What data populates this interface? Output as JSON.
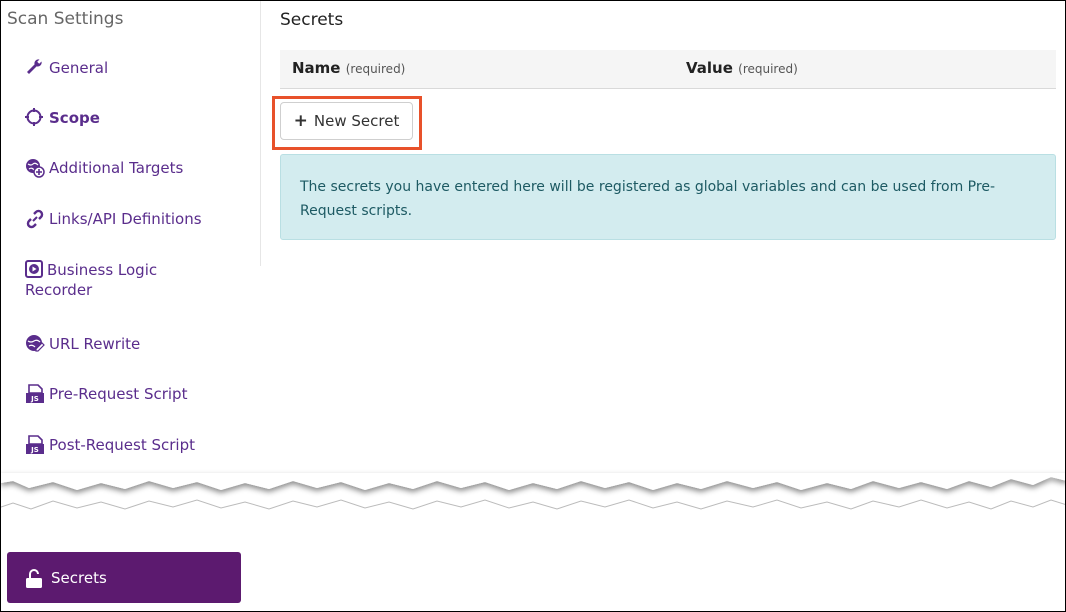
{
  "sidebar": {
    "title": "Scan Settings",
    "items": [
      {
        "label": "General",
        "icon": "wrench-icon"
      },
      {
        "label": "Scope",
        "icon": "crosshair-icon"
      },
      {
        "label": "Additional Targets",
        "icon": "globe-plus-icon"
      },
      {
        "label": "Links/API Definitions",
        "icon": "link-icon"
      },
      {
        "label": "Business Logic Recorder",
        "label_line1": "Business Logic",
        "label_line2": "Recorder",
        "icon": "play-icon"
      },
      {
        "label": "URL Rewrite",
        "icon": "globe-pencil-icon"
      },
      {
        "label": "Pre-Request Script",
        "icon": "js-file-icon"
      },
      {
        "label": "Post-Request Script",
        "icon": "js-file-icon"
      }
    ],
    "active_item": {
      "label": "Secrets",
      "icon": "unlock-icon"
    }
  },
  "main": {
    "title": "Secrets",
    "table": {
      "columns": [
        {
          "name": "Name",
          "hint": "(required)"
        },
        {
          "name": "Value",
          "hint": "(required)"
        }
      ]
    },
    "new_button_label": "New Secret",
    "info_text": "The secrets you have entered here will be registered as global variables and can be used from Pre-Request scripts."
  },
  "colors": {
    "accent": "#5a2d8c",
    "active_bg": "#5c1a6f",
    "info_bg": "#d3ecef",
    "highlight": "#e8512a"
  }
}
